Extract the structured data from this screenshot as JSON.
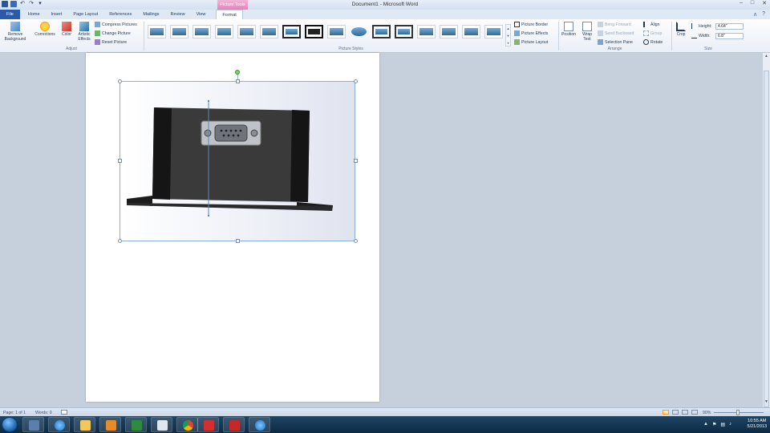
{
  "window": {
    "title": "Document1 - Microsoft Word",
    "context_tab_header": "Picture Tools",
    "controls": [
      "–",
      "□",
      "✕"
    ]
  },
  "qat": {
    "undo": "↶",
    "redo": "↷",
    "customize": "▾"
  },
  "tabs": [
    {
      "label": "File"
    },
    {
      "label": "Home"
    },
    {
      "label": "Insert"
    },
    {
      "label": "Page Layout"
    },
    {
      "label": "References"
    },
    {
      "label": "Mailings"
    },
    {
      "label": "Review"
    },
    {
      "label": "View"
    },
    {
      "label": "Format"
    }
  ],
  "ribbon_right": {
    "minimize": "∧",
    "help": "?"
  },
  "ribbon": {
    "adjust": {
      "remove_background": "Remove Background",
      "corrections": "Corrections",
      "color": "Color",
      "artistic_effects": "Artistic Effects",
      "compress": "Compress Pictures",
      "change": "Change Picture",
      "reset": "Reset Picture",
      "label": "Adjust"
    },
    "styles": {
      "label": "Picture Styles",
      "picture_border": "Picture Border",
      "picture_effects": "Picture Effects",
      "picture_layout": "Picture Layout"
    },
    "arrange": {
      "label": "Arrange",
      "position": "Position",
      "wrap_text": "Wrap Text",
      "bring_forward": "Bring Forward",
      "send_backward": "Send Backward",
      "selection_pane": "Selection Pane",
      "align": "Align",
      "group": "Group",
      "rotate": "Rotate"
    },
    "size": {
      "label": "Size",
      "crop": "Crop",
      "height_label": "Height:",
      "height_value": "4.64\"",
      "width_label": "Width:",
      "width_value": "6.8\""
    }
  },
  "statusbar": {
    "page": "Page: 1 of 1",
    "words": "Words: 0",
    "zoom": "90%"
  },
  "taskbar": {
    "apps": [
      "file-explorer-icon",
      "ie-icon",
      "folder-icon",
      "media-player-icon",
      "excel-icon",
      "window-icon",
      "chrome-icon",
      "solidworks-icon",
      "acrobat-icon",
      "ie-icon"
    ],
    "time": "10:55 AM",
    "date": "5/21/2013"
  },
  "colors": {
    "file_tab": "#2a5aa9",
    "context_tab": "#e97fb9",
    "taskbar": "#0e2a42",
    "selection": "#8ab0d9"
  }
}
